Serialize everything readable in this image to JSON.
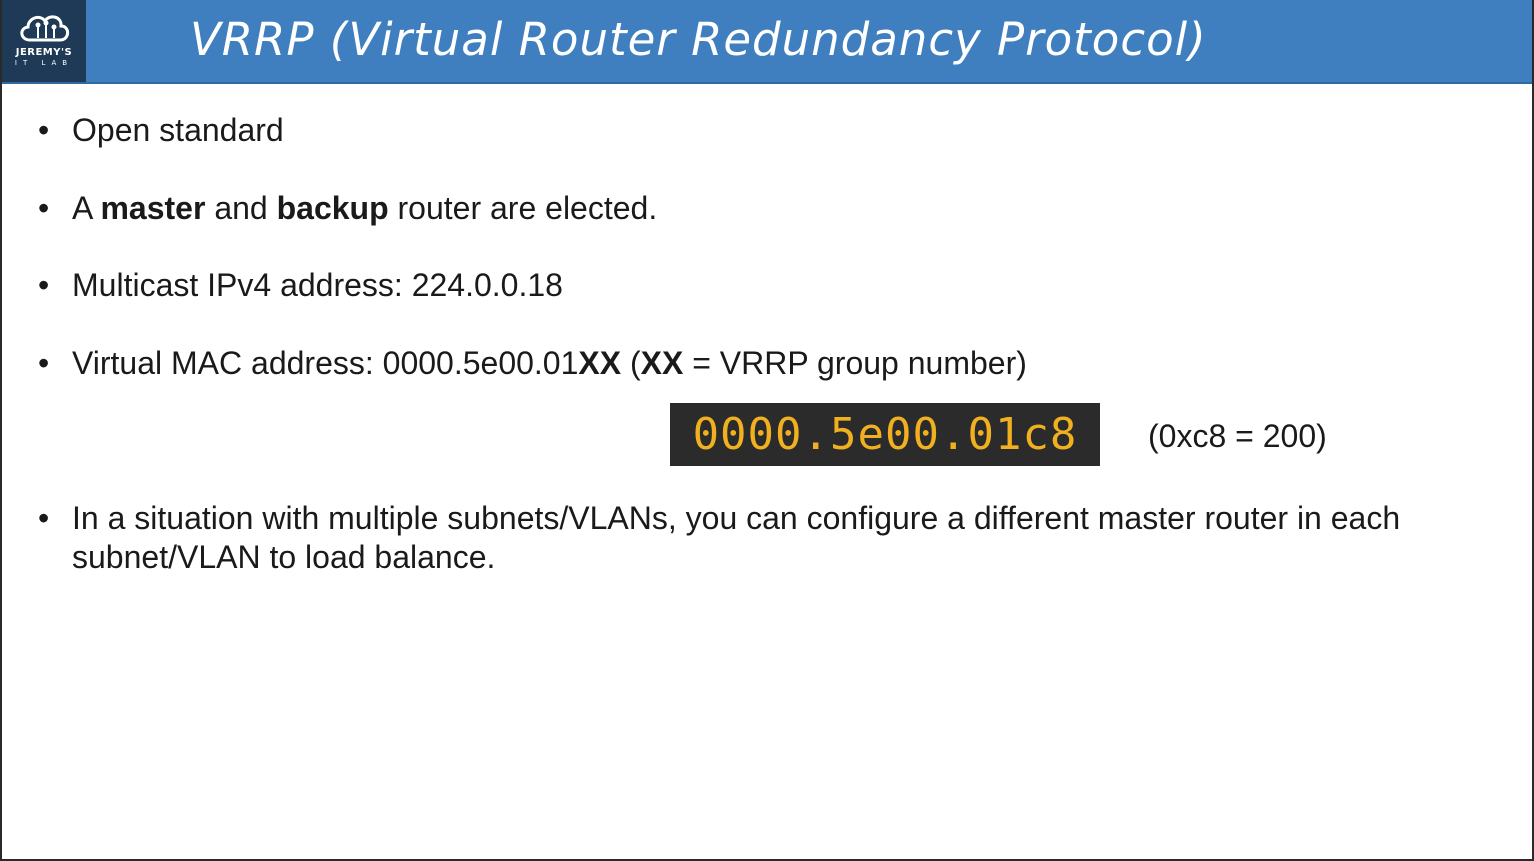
{
  "header": {
    "title": "VRRP (Virtual Router Redundancy Protocol)",
    "logo_name": "JEREMY'S",
    "logo_sub": "IT LAB",
    "logo_icon": "cloud-circuit-icon"
  },
  "bullets": {
    "b1": {
      "text": "Open standard"
    },
    "b2": {
      "pre": "A ",
      "bold1": "master",
      "mid": " and ",
      "bold2": "backup",
      "post": " router are elected."
    },
    "b3": {
      "text": "Multicast IPv4 address: 224.0.0.18"
    },
    "b4": {
      "pre": "Virtual MAC address: 0000.5e00.01",
      "bold1": "XX",
      "mid": " (",
      "bold2": "XX",
      "post": " = VRRP group number)"
    },
    "b5": {
      "text": "In a situation with multiple subnets/VLANs, you can configure a different master router in each subnet/VLAN to load balance."
    }
  },
  "example": {
    "mac": "0000.5e00.01c8",
    "note": "(0xc8 = 200)"
  },
  "colors": {
    "header_bg": "#3f7fbf",
    "logo_bg": "#1e3a56",
    "mac_box_bg": "#2b2b2b",
    "mac_text": "#f0b020"
  }
}
